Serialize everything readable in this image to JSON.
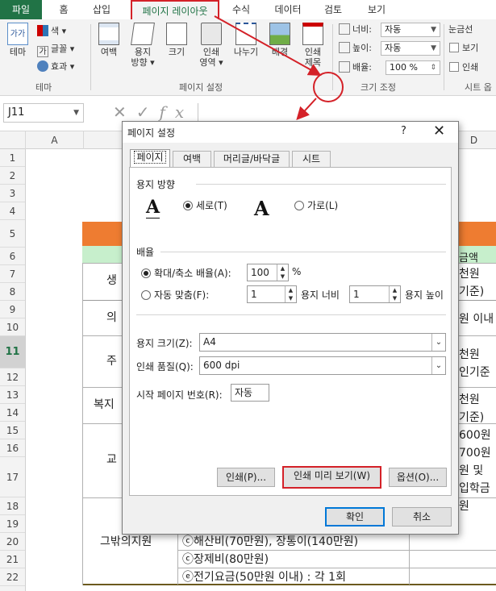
{
  "ribbon": {
    "tabs": [
      "파일",
      "홈",
      "삽입",
      "페이지 레이아웃",
      "수식",
      "데이터",
      "검토",
      "보기"
    ],
    "theme_group": {
      "theme_label": "테마",
      "colors_label": "색",
      "fonts_label": "글꼴",
      "effects_label": "효과",
      "group_label": "테마",
      "theme_icon_text": "가가"
    },
    "page_setup_group": {
      "margins_label": "여백",
      "orientation_label_1": "용지",
      "orientation_label_2": "방향",
      "size_label": "크기",
      "print_area_label_1": "인쇄",
      "print_area_label_2": "영역",
      "breaks_label": "나누기",
      "background_label": "배경",
      "print_titles_label_1": "인쇄",
      "print_titles_label_2": "제목",
      "group_label": "페이지 설정"
    },
    "scale_group": {
      "width_label": "너비:",
      "width_value": "자동",
      "height_label": "높이:",
      "height_value": "자동",
      "scale_label": "배율:",
      "scale_value": "100 %",
      "group_label": "크기 조정"
    },
    "sheet_options_group": {
      "gridlines_label": "눈금선",
      "view_label": "보기",
      "print_label": "인쇄",
      "group_label": "시트 옵"
    }
  },
  "formula_bar": {
    "name_box": "J11",
    "fx_label": "fx"
  },
  "sheet": {
    "columns": [
      "A",
      "D"
    ],
    "rows": [
      "1",
      "2",
      "3",
      "4",
      "5",
      "6",
      "7",
      "8",
      "9",
      "10",
      "11",
      "12",
      "13",
      "14",
      "15",
      "16",
      "17",
      "18",
      "19",
      "20",
      "21",
      "22"
    ],
    "selected_row": "11",
    "left_labels": [
      "생",
      "의",
      "주",
      "복지",
      "교",
      "그밖의지원"
    ],
    "right_values": [
      "천원",
      "금액",
      "기준)",
      "원 이내",
      "천원",
      "인기준",
      "천원",
      "기준)",
      "600원",
      "700원",
      "원 및",
      "입학금",
      "원"
    ],
    "bottom_rows": [
      "ⓒ해산비(70만원), 장통이(140만원)",
      "ⓒ장제비(80만원)",
      "ⓔ전기요금(50만원 이내) : 각 1회"
    ]
  },
  "dialog": {
    "title": "페이지 설정",
    "help": "?",
    "close": "✕",
    "tabs": [
      "페이지",
      "여백",
      "머리글/바닥글",
      "시트"
    ],
    "orientation": {
      "section": "용지 방향",
      "portrait": "세로(T)",
      "landscape": "가로(L)",
      "selected": "portrait",
      "icon_text": "A"
    },
    "scaling": {
      "section": "배율",
      "adjust_label": "확대/축소 배율(A):",
      "adjust_value": "100",
      "percent": "%",
      "fit_label": "자동 맞춤(F):",
      "fit_wide": "1",
      "wide_label": "용지 너비",
      "fit_tall": "1",
      "tall_label": "용지 높이",
      "selected": "adjust"
    },
    "paper_size_label": "용지 크기(Z):",
    "paper_size_value": "A4",
    "print_quality_label": "인쇄 품질(Q):",
    "print_quality_value": "600 dpi",
    "first_page_label": "시작 페이지 번호(R):",
    "first_page_value": "자동",
    "buttons": {
      "print": "인쇄(P)...",
      "print_preview": "인쇄 미리 보기(W)",
      "options": "옵션(O)...",
      "ok": "확인",
      "cancel": "취소"
    }
  },
  "colors": {
    "excel_green": "#217346",
    "highlight_red": "#d42128",
    "header_orange": "#ee7c31",
    "row_green": "#c7efcc"
  }
}
